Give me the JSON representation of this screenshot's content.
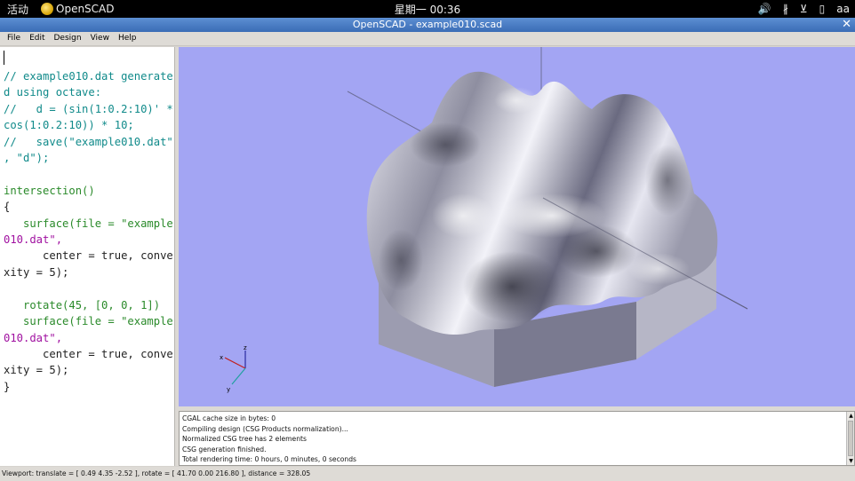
{
  "topbar": {
    "activities": "活动",
    "app_name": "OpenSCAD",
    "clock": "星期一 00:36",
    "tray": {
      "volume": "🔊",
      "bluetooth": "∦",
      "network": "⊻",
      "battery": "▯",
      "user": "aa"
    }
  },
  "window": {
    "title": "OpenSCAD - example010.scad",
    "close": "✕"
  },
  "menu": [
    "File",
    "Edit",
    "Design",
    "View",
    "Help"
  ],
  "editor": {
    "lines": [
      "// example010.dat generate",
      "d using octave:",
      "//   d = (sin(1:0.2:10)' *",
      "cos(1:0.2:10)) * 10;",
      "//   save(\"example010.dat\"",
      ", \"d\");",
      "",
      "intersection()",
      "{",
      "   surface(file = \"example",
      "010.dat\",",
      "      center = true, conve",
      "xity = 5);",
      "",
      "   rotate(45, [0, 0, 1])",
      "   surface(file = \"example",
      "010.dat\",",
      "      center = true, conve",
      "xity = 5);",
      "}"
    ]
  },
  "viewport": {
    "background": "#a3a5f3",
    "axes_labels": {
      "x": "x",
      "y": "y",
      "z": "z"
    }
  },
  "console": {
    "lines": [
      "CGAL cache size in bytes: 0",
      "Compiling design (CSG Products normalization)...",
      "Normalized CSG tree has 2 elements",
      "CSG generation finished.",
      "Total rendering time: 0 hours, 0 minutes, 0 seconds"
    ]
  },
  "status": "Viewport: translate = [ 0.49 4.35 -2.52 ], rotate = [ 41.70 0.00 216.80 ], distance = 328.05"
}
